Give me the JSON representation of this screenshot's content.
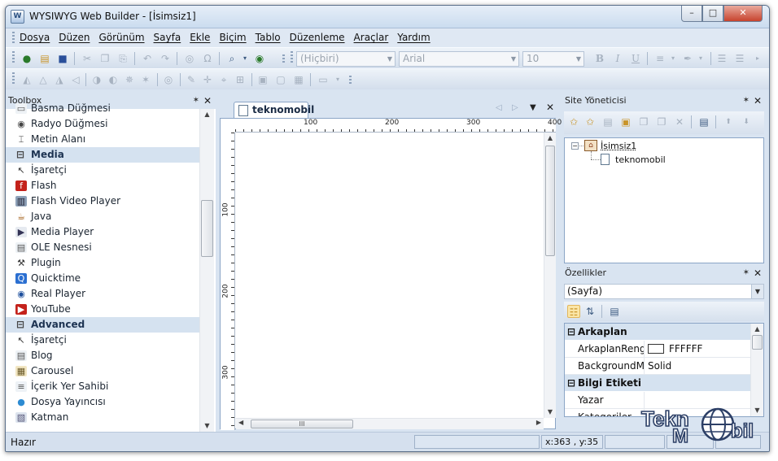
{
  "window": {
    "title": "WYSIWYG Web Builder - [İsimsiz1]"
  },
  "menu": [
    "Dosya",
    "Düzen",
    "Görünüm",
    "Sayfa",
    "Ekle",
    "Biçim",
    "Tablo",
    "Düzenleme",
    "Araçlar",
    "Yardım"
  ],
  "format_toolbar": {
    "style_combo": "(Hiçbiri)",
    "font_combo": "Arial",
    "size_combo": "10",
    "bold": "B",
    "italic": "I",
    "underline": "U"
  },
  "toolbox": {
    "title": "Toolbox",
    "items": [
      {
        "type": "item",
        "label": "Basma Düğmesi",
        "icon": "button-icon"
      },
      {
        "type": "item",
        "label": "Radyo Düğmesi",
        "icon": "radio-icon"
      },
      {
        "type": "item",
        "label": "Metin Alanı",
        "icon": "textarea-icon"
      },
      {
        "type": "cat",
        "label": "Media"
      },
      {
        "type": "item",
        "label": "İşaretçi",
        "icon": "pointer-icon"
      },
      {
        "type": "item",
        "label": "Flash",
        "icon": "flash-icon"
      },
      {
        "type": "item",
        "label": "Flash Video Player",
        "icon": "film-icon"
      },
      {
        "type": "item",
        "label": "Java",
        "icon": "java-icon"
      },
      {
        "type": "item",
        "label": "Media Player",
        "icon": "media-player-icon"
      },
      {
        "type": "item",
        "label": "OLE Nesnesi",
        "icon": "ole-icon"
      },
      {
        "type": "item",
        "label": "Plugin",
        "icon": "plugin-icon"
      },
      {
        "type": "item",
        "label": "Quicktime",
        "icon": "quicktime-icon"
      },
      {
        "type": "item",
        "label": "Real Player",
        "icon": "realplayer-icon"
      },
      {
        "type": "item",
        "label": "YouTube",
        "icon": "youtube-icon"
      },
      {
        "type": "cat",
        "label": "Advanced"
      },
      {
        "type": "item",
        "label": "İşaretçi",
        "icon": "pointer-icon"
      },
      {
        "type": "item",
        "label": "Blog",
        "icon": "blog-icon"
      },
      {
        "type": "item",
        "label": "Carousel",
        "icon": "carousel-icon"
      },
      {
        "type": "item",
        "label": "İçerik Yer Sahibi",
        "icon": "placeholder-icon"
      },
      {
        "type": "item",
        "label": "Dosya Yayıncısı",
        "icon": "globe-icon"
      },
      {
        "type": "item",
        "label": "Katman",
        "icon": "layer-icon"
      }
    ]
  },
  "document": {
    "tab_label": "teknomobil",
    "ruler_top": [
      "100",
      "200",
      "300",
      "400"
    ],
    "ruler_left": [
      "100",
      "200",
      "300"
    ],
    "hscroll_grip": "III"
  },
  "site_manager": {
    "title": "Site Yöneticisi",
    "root": "İsimsiz1",
    "page": "teknomobil"
  },
  "properties": {
    "title": "Özellikler",
    "selected": "(Sayfa)",
    "cat1": "Arkaplan",
    "cat2": "Bilgi Etiketi",
    "rows": [
      {
        "key": "ArkaplanRengi",
        "value": "FFFFFF"
      },
      {
        "key": "BackgroundMode",
        "value": "Solid"
      }
    ],
    "rows2": [
      {
        "key": "Yazar",
        "value": ""
      },
      {
        "key": "Kategoriler",
        "value": ""
      }
    ]
  },
  "status": {
    "text": "Hazır",
    "coords": "x:363 , y:35"
  },
  "watermark": {
    "left": "Tekn",
    "right": "bil",
    "mid": "M"
  },
  "colors": {
    "accent": "#1d3352",
    "category_bg": "#d5e2f0",
    "frame": "#d9e4f1"
  }
}
